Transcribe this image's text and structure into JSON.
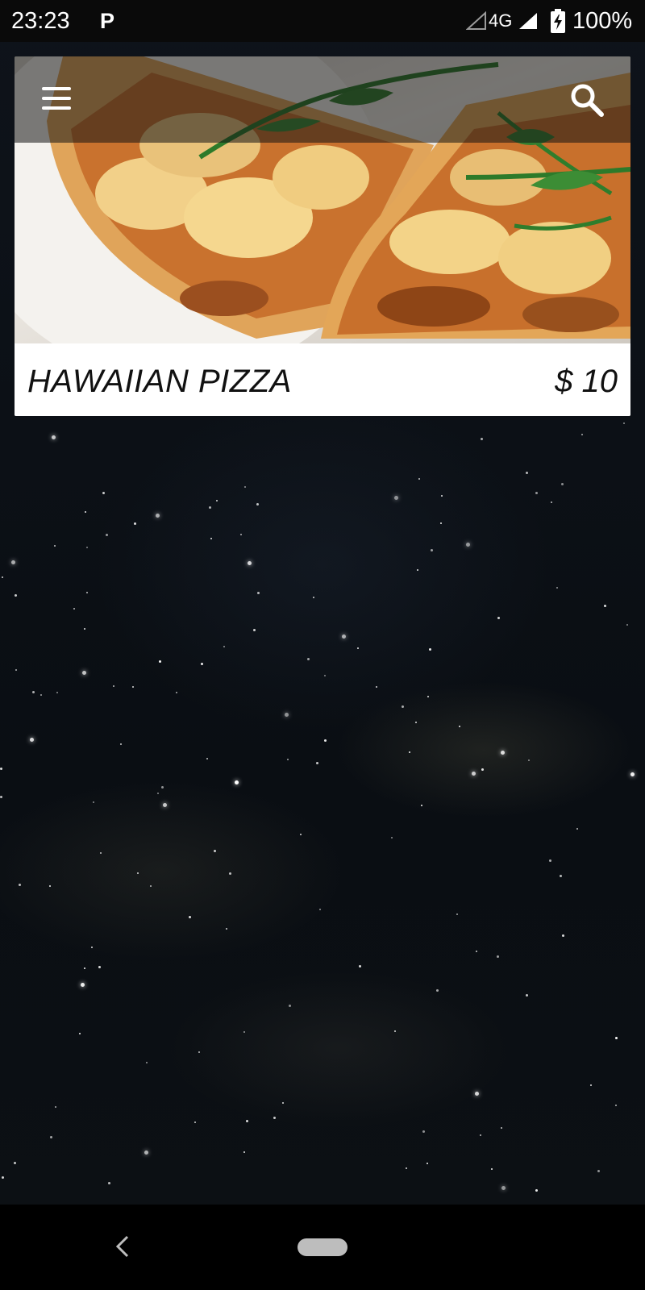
{
  "status_bar": {
    "time": "23:23",
    "notification_icon": "parking-icon",
    "notification_glyph": "P",
    "network": "4G",
    "battery_percent": "100%",
    "battery_icon": "battery-charging-icon"
  },
  "toolbar": {
    "menu_icon": "hamburger-menu-icon",
    "search_icon": "search-icon"
  },
  "menu_items": [
    {
      "name": "HAWAIIAN PIZZA",
      "price": "$ 10",
      "image": "hawaiian-pizza-photo"
    }
  ],
  "nav_bar": {
    "back_icon": "back-chevron-icon",
    "home_icon": "home-pill-icon"
  },
  "colors": {
    "background": "#0b0f15",
    "card": "#ffffff",
    "text": "#111111"
  }
}
